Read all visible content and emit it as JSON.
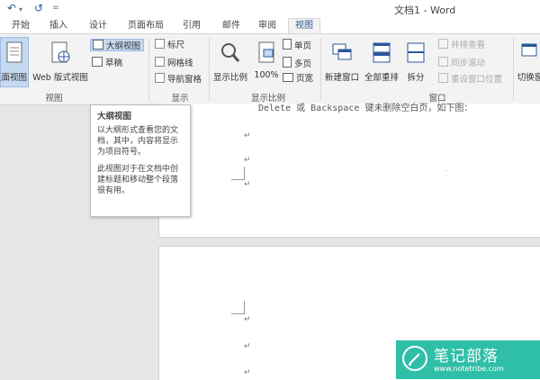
{
  "window": {
    "title": "文档1 - Word"
  },
  "quick_access": {
    "undo_icon": "↶",
    "redo_icon": "↺",
    "customize_icon": "="
  },
  "tabs": [
    {
      "label": "开始"
    },
    {
      "label": "插入"
    },
    {
      "label": "设计"
    },
    {
      "label": "页面布局"
    },
    {
      "label": "引用"
    },
    {
      "label": "邮件"
    },
    {
      "label": "审阅"
    },
    {
      "label": "视图"
    }
  ],
  "ribbon": {
    "views": {
      "page_view": "页面视图",
      "web_view": "Web 版式视图",
      "outline": "大纲视图",
      "draft": "草稿",
      "group_label": "视图"
    },
    "show": {
      "ruler": "标尺",
      "gridlines": "网格线",
      "nav_pane": "导航窗格",
      "group_label": "显示"
    },
    "zoom": {
      "zoom": "显示比例",
      "hundred": "100%",
      "one_page": "单页",
      "multi_page": "多页",
      "page_width": "页宽",
      "group_label": "显示比例"
    },
    "window": {
      "new_window": "新建窗口",
      "arrange_all": "全部重排",
      "split": "拆分",
      "side_by_side": "并排查看",
      "sync_scroll": "同步滚动",
      "reset_pos": "重设窗口位置",
      "switch": "切换窗",
      "group_label": "窗口"
    }
  },
  "tooltip": {
    "title": "大纲视图",
    "para1": "以大纲形式查看您的文档，其中，内容将显示为项目符号。",
    "para2": "此视图对于在文档中创建标题和移动整个段落很有用。"
  },
  "document": {
    "line1": "Delete 或 Backspace 键未删除空白页，如下图：",
    "para_mark": "↵"
  },
  "watermark": {
    "name": "笔记部落",
    "url": "www.notetribe.com"
  },
  "colors": {
    "accent": "#2b579a",
    "ribbon_bg": "#f3f3f3",
    "watermark": "#2fbfa8"
  }
}
